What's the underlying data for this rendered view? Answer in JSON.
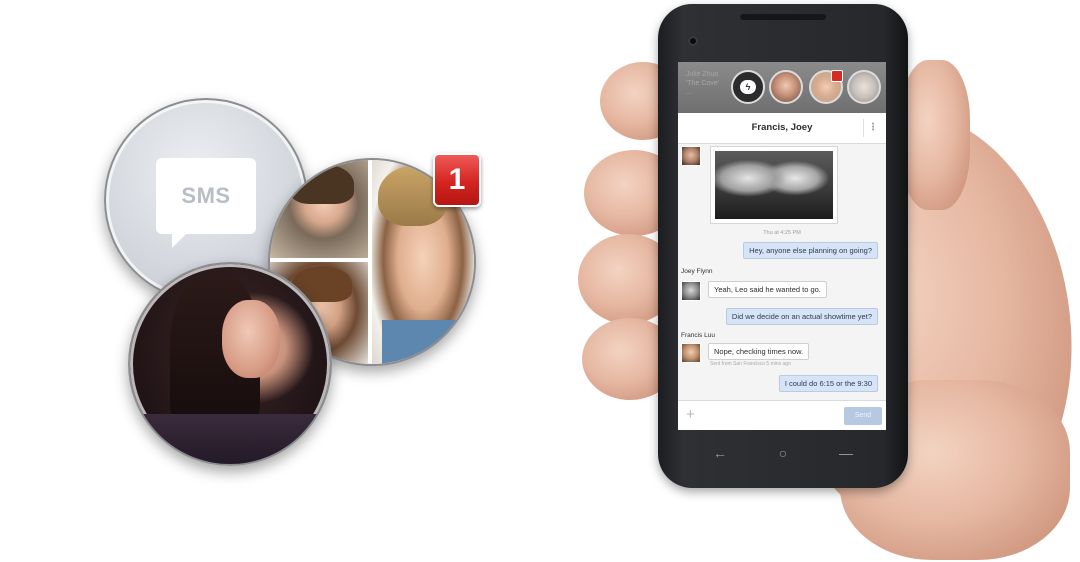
{
  "left_graphic": {
    "sms_label": "SMS",
    "notification_count": "1"
  },
  "phone": {
    "chat_title": "Francis, Joey",
    "ghost_text": [
      "Julie Zhuo",
      "'The Cove'",
      "...",
      "..."
    ],
    "photo_timestamp": "Thu at 4:25 PM",
    "messages": [
      {
        "sender": "",
        "text": "Hey, anyone else planning on going?",
        "direction": "out"
      },
      {
        "sender": "Joey Flynn",
        "text": "Yeah, Leo said he wanted to go.",
        "direction": "in"
      },
      {
        "sender": "",
        "text": "Did we decide on an actual showtime yet?",
        "direction": "out"
      },
      {
        "sender": "Francis Luu",
        "text": "Nope, checking times now.",
        "direction": "in"
      },
      {
        "sender": "",
        "text": "I could do 6:15 or the 9:30",
        "direction": "out"
      }
    ],
    "sent_note": "Sent from San Francisco 5 mins ago",
    "composer": {
      "send_label": "Send",
      "add_glyph": "+"
    },
    "nav": {
      "back": "←",
      "home": "○",
      "recents": "—"
    },
    "menu_glyph": "⋮"
  }
}
